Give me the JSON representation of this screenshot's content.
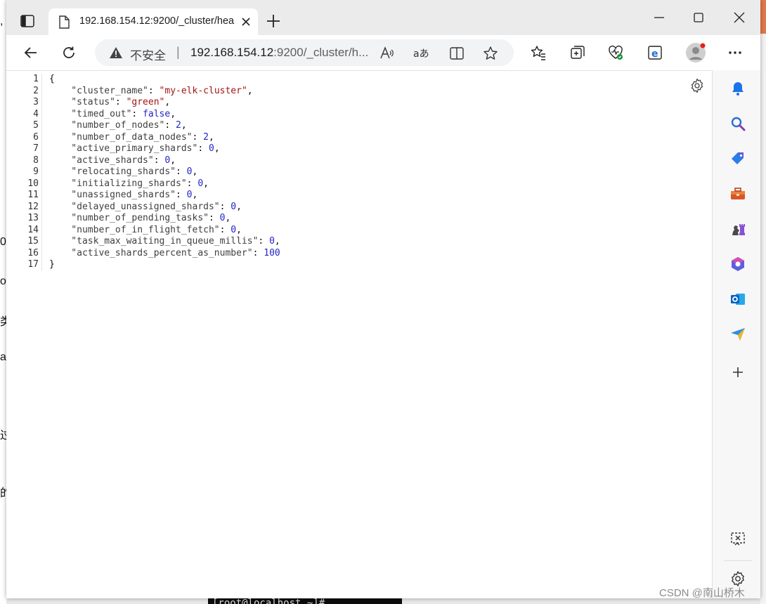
{
  "tab": {
    "title": "192.168.154.12:9200/_cluster/hea"
  },
  "address": {
    "security_label": "不安全",
    "separator": "|",
    "url_host": "192.168.154.12",
    "url_rest": ":9200/_cluster/h..."
  },
  "json_lines": [
    {
      "n": "1",
      "parts": [
        {
          "t": "{",
          "c": "p"
        }
      ]
    },
    {
      "n": "2",
      "parts": [
        {
          "t": "    \"cluster_name\"",
          "c": "k"
        },
        {
          "t": ": ",
          "c": "p"
        },
        {
          "t": "\"my-elk-cluster\"",
          "c": "s"
        },
        {
          "t": ",",
          "c": "p"
        }
      ]
    },
    {
      "n": "3",
      "parts": [
        {
          "t": "    \"status\"",
          "c": "k"
        },
        {
          "t": ": ",
          "c": "p"
        },
        {
          "t": "\"green\"",
          "c": "s"
        },
        {
          "t": ",",
          "c": "p"
        }
      ]
    },
    {
      "n": "4",
      "parts": [
        {
          "t": "    \"timed_out\"",
          "c": "k"
        },
        {
          "t": ": ",
          "c": "p"
        },
        {
          "t": "false",
          "c": "b"
        },
        {
          "t": ",",
          "c": "p"
        }
      ]
    },
    {
      "n": "5",
      "parts": [
        {
          "t": "    \"number_of_nodes\"",
          "c": "k"
        },
        {
          "t": ": ",
          "c": "p"
        },
        {
          "t": "2",
          "c": "n"
        },
        {
          "t": ",",
          "c": "p"
        }
      ]
    },
    {
      "n": "6",
      "parts": [
        {
          "t": "    \"number_of_data_nodes\"",
          "c": "k"
        },
        {
          "t": ": ",
          "c": "p"
        },
        {
          "t": "2",
          "c": "n"
        },
        {
          "t": ",",
          "c": "p"
        }
      ]
    },
    {
      "n": "7",
      "parts": [
        {
          "t": "    \"active_primary_shards\"",
          "c": "k"
        },
        {
          "t": ": ",
          "c": "p"
        },
        {
          "t": "0",
          "c": "n"
        },
        {
          "t": ",",
          "c": "p"
        }
      ]
    },
    {
      "n": "8",
      "parts": [
        {
          "t": "    \"active_shards\"",
          "c": "k"
        },
        {
          "t": ": ",
          "c": "p"
        },
        {
          "t": "0",
          "c": "n"
        },
        {
          "t": ",",
          "c": "p"
        }
      ]
    },
    {
      "n": "9",
      "parts": [
        {
          "t": "    \"relocating_shards\"",
          "c": "k"
        },
        {
          "t": ": ",
          "c": "p"
        },
        {
          "t": "0",
          "c": "n"
        },
        {
          "t": ",",
          "c": "p"
        }
      ]
    },
    {
      "n": "10",
      "parts": [
        {
          "t": "    \"initializing_shards\"",
          "c": "k"
        },
        {
          "t": ": ",
          "c": "p"
        },
        {
          "t": "0",
          "c": "n"
        },
        {
          "t": ",",
          "c": "p"
        }
      ]
    },
    {
      "n": "11",
      "parts": [
        {
          "t": "    \"unassigned_shards\"",
          "c": "k"
        },
        {
          "t": ": ",
          "c": "p"
        },
        {
          "t": "0",
          "c": "n"
        },
        {
          "t": ",",
          "c": "p"
        }
      ]
    },
    {
      "n": "12",
      "parts": [
        {
          "t": "    \"delayed_unassigned_shards\"",
          "c": "k"
        },
        {
          "t": ": ",
          "c": "p"
        },
        {
          "t": "0",
          "c": "n"
        },
        {
          "t": ",",
          "c": "p"
        }
      ]
    },
    {
      "n": "13",
      "parts": [
        {
          "t": "    \"number_of_pending_tasks\"",
          "c": "k"
        },
        {
          "t": ": ",
          "c": "p"
        },
        {
          "t": "0",
          "c": "n"
        },
        {
          "t": ",",
          "c": "p"
        }
      ]
    },
    {
      "n": "14",
      "parts": [
        {
          "t": "    \"number_of_in_flight_fetch\"",
          "c": "k"
        },
        {
          "t": ": ",
          "c": "p"
        },
        {
          "t": "0",
          "c": "n"
        },
        {
          "t": ",",
          "c": "p"
        }
      ]
    },
    {
      "n": "15",
      "parts": [
        {
          "t": "    \"task_max_waiting_in_queue_millis\"",
          "c": "k"
        },
        {
          "t": ": ",
          "c": "p"
        },
        {
          "t": "0",
          "c": "n"
        },
        {
          "t": ",",
          "c": "p"
        }
      ]
    },
    {
      "n": "16",
      "parts": [
        {
          "t": "    \"active_shards_percent_as_number\"",
          "c": "k"
        },
        {
          "t": ": ",
          "c": "p"
        },
        {
          "t": "100",
          "c": "n"
        }
      ]
    },
    {
      "n": "17",
      "parts": [
        {
          "t": "}",
          "c": "p"
        }
      ]
    }
  ],
  "background": {
    "terminal_text": "[root@localhost ~]#",
    "watermark": "CSDN @南山桥木"
  },
  "icons": {
    "tab_actions": "vertical-tabs-icon",
    "favicon": "page-icon",
    "sidebar": [
      "bell-icon",
      "search-icon",
      "shopping-tag-icon",
      "toolbox-icon",
      "games-icon",
      "office-icon",
      "outlook-icon",
      "send-icon",
      "add-icon",
      "screenshot-icon",
      "settings-icon"
    ]
  },
  "colors": {
    "string": "#a31515",
    "number": "#2323c8",
    "key": "#404040",
    "warning": "#444444"
  }
}
